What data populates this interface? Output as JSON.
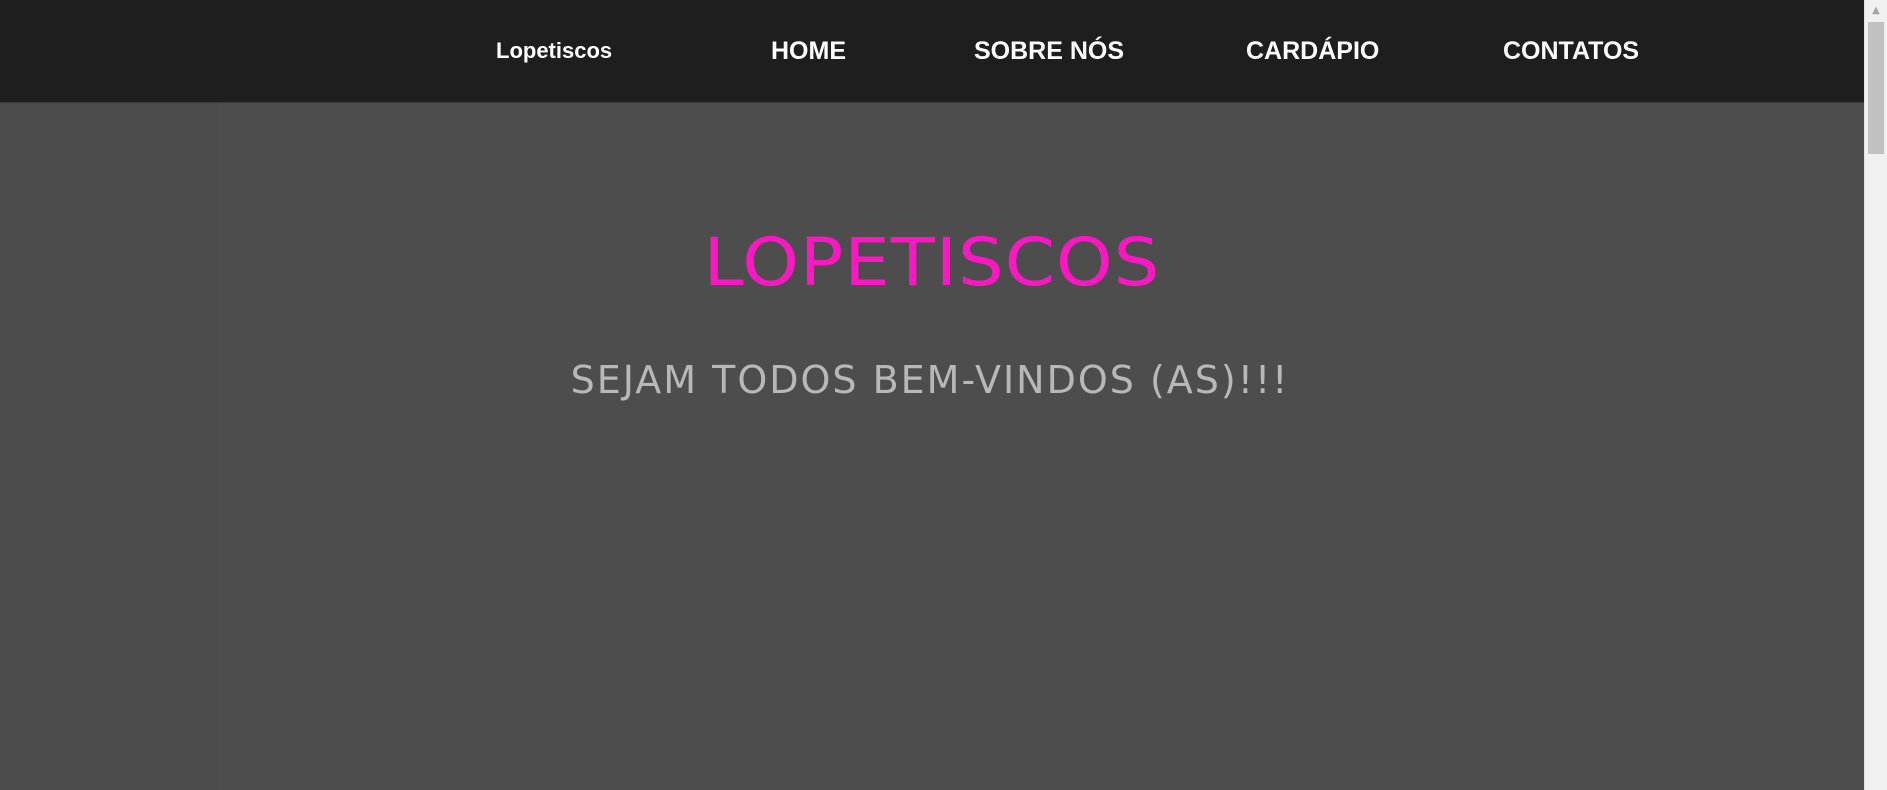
{
  "navbar": {
    "brand": "Lopetiscos",
    "links": [
      {
        "label": "HOME"
      },
      {
        "label": "SOBRE NÓS"
      },
      {
        "label": "CARDÁPIO"
      },
      {
        "label": "CONTATOS"
      }
    ]
  },
  "hero": {
    "title": "LOPETISCOS",
    "subtitle": "SEJAM TODOS BEM-VINDOS (AS)!!!"
  },
  "scrollbar": {
    "up_icon": "▲"
  },
  "colors": {
    "navbar_bg": "#1e1e1e",
    "hero_bg": "#4b4b4b",
    "title": "#ff17c4",
    "subtitle": "#b8b8b8"
  }
}
